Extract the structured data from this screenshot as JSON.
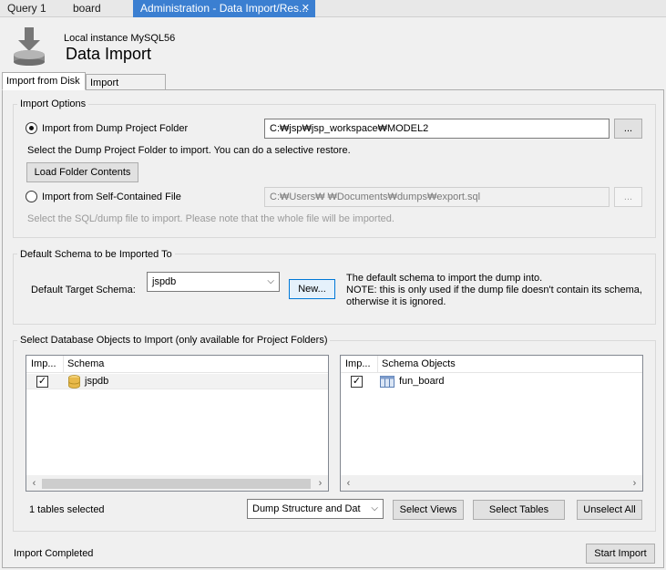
{
  "doc_tabs": [
    {
      "label": "Query 1"
    },
    {
      "label": "board"
    },
    {
      "label": "Administration - Data Import/Res..."
    }
  ],
  "header": {
    "subtitle": "Local instance MySQL56",
    "title": "Data Import",
    "icon": "import-icon"
  },
  "tabs": [
    {
      "label": "Import from Disk",
      "active": true
    },
    {
      "label": "Import Progress",
      "active": false
    }
  ],
  "import_options": {
    "title": "Import Options",
    "dump_folder_label": "Import from Dump Project Folder",
    "dump_folder_path": "C:₩jsp₩jsp_workspace₩MODEL2",
    "dump_folder_help": "Select the Dump Project Folder to import. You can do a selective restore.",
    "load_button": "Load Folder Contents",
    "self_contained_label": "Import from Self-Contained File",
    "self_contained_path": "C:₩Users₩          ₩Documents₩dumps₩export.sql",
    "self_contained_help": "Select the SQL/dump file to import. Please note that the whole file will be imported.",
    "browse_label": "...",
    "selected_option": "dump_folder"
  },
  "default_schema": {
    "title": "Default Schema to be Imported To",
    "target_label": "Default Target Schema:",
    "target_value": "jspdb",
    "new_button": "New...",
    "note_line1": "The default schema to import the dump into.",
    "note_line2": "NOTE: this is only used if the dump file doesn't contain its schema,",
    "note_line3": "otherwise it is ignored."
  },
  "db_objects": {
    "title": "Select Database Objects to Import (only available for Project Folders)",
    "left_list": {
      "col_import": "Imp...",
      "col_name": "Schema",
      "rows": [
        {
          "name": "jspdb",
          "checked": true
        }
      ]
    },
    "right_list": {
      "col_import": "Imp...",
      "col_name": "Schema Objects",
      "rows": [
        {
          "name": "fun_board",
          "checked": true
        }
      ]
    },
    "tables_selected": "1 tables selected",
    "dump_mode": "Dump Structure and Dat",
    "select_views": "Select Views",
    "select_tables": "Select Tables",
    "unselect_all": "Unselect All"
  },
  "footer": {
    "status": "Import Completed",
    "start_button": "Start Import"
  },
  "colors": {
    "active_tab": "#3b7fd1",
    "focus_border": "#0078d7"
  }
}
